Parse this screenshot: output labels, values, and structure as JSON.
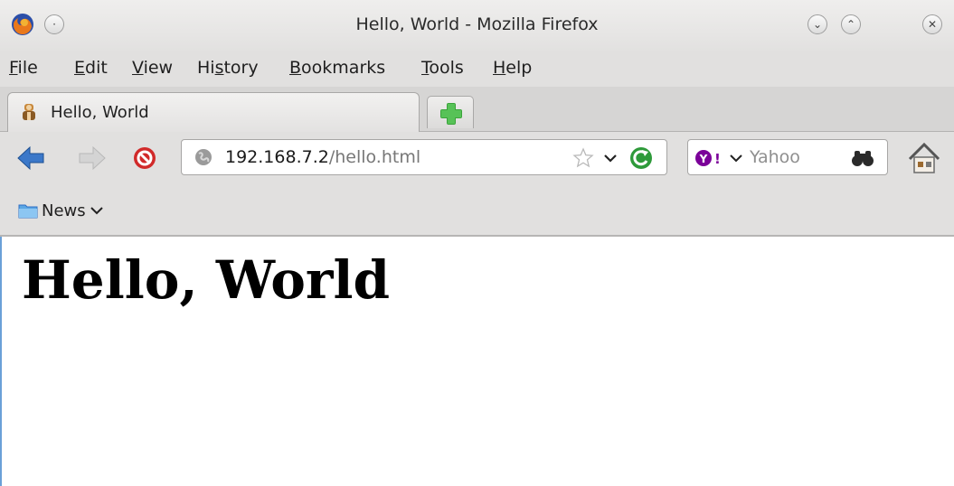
{
  "window": {
    "title": "Hello, World - Mozilla Firefox",
    "minimize_glyph": "⌄",
    "maximize_glyph": "⌃",
    "close_glyph": "✕"
  },
  "menu": [
    "File",
    "Edit",
    "View",
    "History",
    "Bookmarks",
    "Tools",
    "Help"
  ],
  "menu_mnemonics": [
    {
      "pre": "",
      "u": "F",
      "post": "ile"
    },
    {
      "pre": "",
      "u": "E",
      "post": "dit"
    },
    {
      "pre": "",
      "u": "V",
      "post": "iew"
    },
    {
      "pre": "Hi",
      "u": "s",
      "post": "tory"
    },
    {
      "pre": "",
      "u": "B",
      "post": "ookmarks"
    },
    {
      "pre": "",
      "u": "T",
      "post": "ools"
    },
    {
      "pre": "",
      "u": "H",
      "post": "elp"
    }
  ],
  "tabs": [
    {
      "label": "Hello, World"
    }
  ],
  "navigation": {
    "url_host": "192.168.7.2",
    "url_path": "/hello.html",
    "search_engine": "Yahoo",
    "search_placeholder": "Yahoo"
  },
  "bookmarks": [
    {
      "label": "News"
    }
  ],
  "page": {
    "heading": "Hello, World"
  },
  "colors": {
    "accent_blue": "#2f6fc4",
    "reload_green": "#2e9a3a",
    "stop_red": "#d12a2a"
  }
}
